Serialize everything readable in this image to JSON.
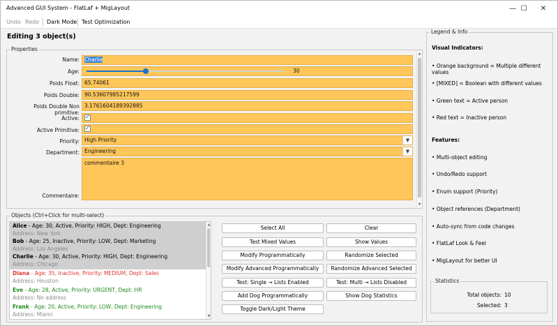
{
  "window": {
    "title": "Advanced GUI System - FlatLaf + MigLayout",
    "minimize_glyph": "—",
    "maximize_glyph": "☐",
    "close_glyph": "✕"
  },
  "menu": {
    "undo": "Undo",
    "redo": "Redo",
    "dark_mode": "Dark Mode",
    "test_optimization": "Test Optimization"
  },
  "editor": {
    "heading": "Editing 3 object(s)",
    "properties_title": "Properties",
    "fields": {
      "name": {
        "label": "Name:",
        "value": "Charlie"
      },
      "age": {
        "label": "Age:",
        "value": "30",
        "slider_fraction": 0.3
      },
      "poids_float": {
        "label": "Poids Float:",
        "value": "65.74061"
      },
      "poids_double": {
        "label": "Poids Double:",
        "value": "90.53607985217599"
      },
      "poids_double_np": {
        "label": "Poids Double Non primitive:",
        "value": "3.1761604189392885"
      },
      "active": {
        "label": "Active:",
        "checked": true
      },
      "active_primitive": {
        "label": "Active Primitive:",
        "checked": true
      },
      "priority": {
        "label": "Priority:",
        "value": "High Priority"
      },
      "department": {
        "label": "Department:",
        "value": "Engineering"
      },
      "commentaire": {
        "label": "Commentaire:",
        "value": "commentaire 3"
      }
    },
    "mixed_color": "#ffc65a"
  },
  "objects": {
    "title": "Objects (Ctrl+Click for multi-select)",
    "items": [
      {
        "name": "Alice",
        "details": " - Age: 30, Active, Priority: HIGH, Dept: Engineering",
        "address": "Address: New York",
        "status": "active",
        "selected": true
      },
      {
        "name": "Bob",
        "details": " - Age: 25, Inactive, Priority: LOW, Dept: Marketing",
        "address": "Address: Los Angeles",
        "status": "active",
        "selected": true
      },
      {
        "name": "Charlie",
        "details": " - Age: 30, Active, Priority: HIGH, Dept: Engineering",
        "address": "Address: Chicago",
        "status": "active",
        "selected": true
      },
      {
        "name": "Diana",
        "details": " - Age: 35, Inactive, Priority: MEDIUM, Dept: Sales",
        "address": "Address: Houston",
        "status": "inactive",
        "selected": false
      },
      {
        "name": "Eve",
        "details": " - Age: 28, Active, Priority: URGENT, Dept: HR",
        "address": "Address: No address",
        "status": "green",
        "selected": false
      },
      {
        "name": "Frank",
        "details": " - Age: 20, Active, Priority: LOW, Dept: Engineering",
        "address": "Address: Miami",
        "status": "green",
        "selected": false
      }
    ]
  },
  "buttons": {
    "select_all": "Select All",
    "clear": "Clear",
    "test_mixed": "Test Mixed Values",
    "show_values": "Show Values",
    "modify_prog": "Modify Programmatically",
    "randomize_selected": "Randomize Selected",
    "modify_adv_prog": "Modify Advanced Programmatically",
    "randomize_adv_selected": "Randomize Advanced Selected",
    "test_single_lists": "Test: Single → Lists Enabled",
    "test_multi_lists": "Test: Multi → Lists Disabled",
    "add_dog": "Add Dog Programmatically",
    "show_dog_stats": "Show Dog Statistics",
    "toggle_theme": "Toggle Dark/Light Theme"
  },
  "legend": {
    "title": "Legend & Info",
    "visual_indicators": "Visual Indicators:",
    "ind1": "• Orange background = Multiple different values",
    "ind2": "• [MIXED] = Boolean with different values",
    "ind3": "• Green text = Active person",
    "ind4": "• Red text = Inactive person",
    "features": "Features:",
    "f1": "• Multi-object editing",
    "f2": "• Undo/Redo support",
    "f3": "• Enum support (Priority)",
    "f4": "• Object references (Department)",
    "f5": "• Auto-sync from code changes",
    "f6": "• FlatLaf Look & Feel",
    "f7": "• MigLayout for better UI"
  },
  "statistics": {
    "title": "Statistics",
    "total_label": "Total objects:",
    "total_value": "10",
    "selected_label": "Selected:",
    "selected_value": "3"
  }
}
